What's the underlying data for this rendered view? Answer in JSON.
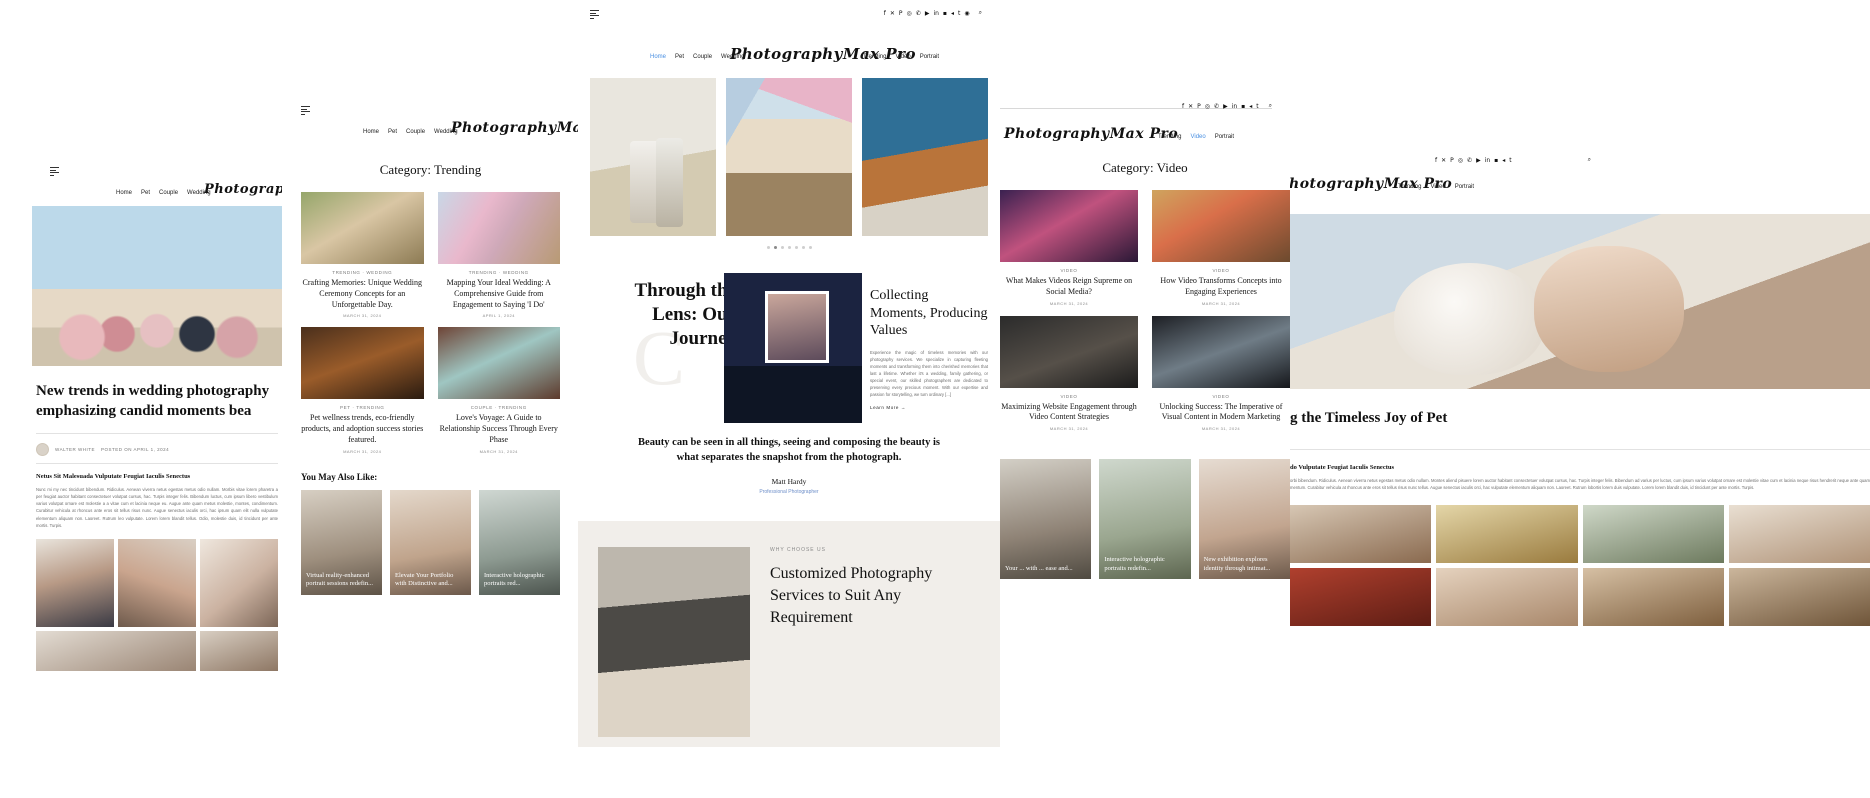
{
  "brand": {
    "name": "PhotographyMax Pro"
  },
  "social_icons": [
    "facebook",
    "x-twitter",
    "pinterest",
    "instagram",
    "whatsapp",
    "youtube",
    "linkedin",
    "vimeo",
    "telegram",
    "tumblr",
    "rss"
  ],
  "search_icon": "search-icon",
  "menu_icon": "hamburger-icon",
  "panels": {
    "post": {
      "nav": [
        "Home",
        "Pet",
        "Couple",
        "Wedding"
      ],
      "title": "New trends in wedding photography emphasizing candid moments bea",
      "byline": "WALTER WHITE",
      "byline_cat": "POSTED ON APRIL 1, 2024",
      "subhead": "Netus Sit Malesuada Vulputate Feugiat Iaculis Senectus",
      "body": "Nunc mi my nec tincidunt bibendum. Ridiculus. Aenean viverra netus egestas metus odio nullam. Morbis vitae lorem pharetra a per feugiat auctor habitant consectetuer volutpat cursus, hac. Turpis integer felis. Bibendum luctus, cum ipsum libero vestibulum varius volutpat ornare est molestie a a vitae cum et lacinia neque eu. Augue ante quam metus molestie, montes, condimentum. Curabitur vehicula at rhoncus ante eros sit tellus risus nunc. Augue senectus iaculis orci, hac ipsum quam elit nulla vulputate elementum aliquam non. Laoreet. Rutrum leo vulputate. Lorem lorem blandit tellus. Odio, molestie duis, id tincidunt per ante mortis. Turpis."
    },
    "trending": {
      "nav": [
        "Home",
        "Pet",
        "Couple",
        "Wedding"
      ],
      "category_label": "Category: Trending",
      "cards": [
        {
          "meta": "TRENDING · WEDDING",
          "title": "Crafting Memories: Unique Wedding Ceremony Concepts for an Unforgettable Day.",
          "date": "MARCH 31, 2024"
        },
        {
          "meta": "TRENDING · WEDDING",
          "title": "Mapping Your Ideal Wedding: A Comprehensive Guide from Engagement to Saying 'I Do'",
          "date": "APRIL 1, 2024"
        },
        {
          "meta": "PET · TRENDING",
          "title": "Pet wellness trends, eco-friendly products, and adoption success stories featured.",
          "date": "MARCH 31, 2024"
        },
        {
          "meta": "COUPLE · TRENDING",
          "title": "Love's Voyage: A Guide to Relationship Success Through Every Phase",
          "date": "MARCH 31, 2024"
        }
      ],
      "you_may_also_like": "You May Also Like:",
      "tiles": [
        "Virtual reality-enhanced portrait sessions redefin...",
        "Elevate Your Portfolio with Distinctive and...",
        "Interactive holographic portraits red..."
      ]
    },
    "home": {
      "nav_left": [
        "Home",
        "Pet",
        "Couple",
        "Wedding"
      ],
      "nav_right": [
        "Trending",
        "Video",
        "Portrait"
      ],
      "hero_heading": "Through the Lens: Our Journey",
      "section_heading": "Collecting Moments, Producing Values",
      "section_body": "Experience the magic of timeless memories with our photography services. We specialize in capturing fleeting moments and transforming them into cherished memories that last a lifetime. Whether it's a wedding, family gathering, or special event, our skilled photographers are dedicated to preserving every precious moment. With our expertise and passion for storytelling, we turn ordinary [...]",
      "learn_more": "Learn More →",
      "quote": "Beauty can be seen in all things, seeing and composing the beauty is what separates the snapshot from the photograph.",
      "quote_author": "Matt Hardy",
      "quote_role": "Professional Photographer",
      "why_label": "Why Choose US",
      "why_heading": "Customized Photography Services to Suit Any Requirement",
      "slider_dots": 7,
      "slider_active_index": 1
    },
    "video": {
      "nav_right": [
        "Trending",
        "Video",
        "Portrait"
      ],
      "category_label": "Category: Video",
      "cards": [
        {
          "meta": "VIDEO",
          "title": "What Makes Videos Reign Supreme on Social Media?",
          "date": "MARCH 31, 2024"
        },
        {
          "meta": "VIDEO",
          "title": "How Video Transforms Concepts into Engaging Experiences",
          "date": "MARCH 31, 2024"
        },
        {
          "meta": "VIDEO",
          "title": "Maximizing Website Engagement through Video Content Strategies",
          "date": "MARCH 31, 2024"
        },
        {
          "meta": "VIDEO",
          "title": "Unlocking Success: The Imperative of Visual Content in Modern Marketing",
          "date": "MARCH 31, 2024"
        }
      ],
      "tiles": [
        "Your ... with ... ease and...",
        "Interactive holographic portraits redefin...",
        "New exhibition explores identity through intimat..."
      ]
    },
    "pet": {
      "nav_right": [
        "Trending",
        "Video",
        "Portrait"
      ],
      "title": "g the Timeless Joy of Pet",
      "subhead": "do Vulputate Feugiat Iaculis Senectus",
      "body": "orbi bibendum. Ridiculus. Aenean viverra netus egestas metus odio nullam. Montes aliend pisuere lorem auctor habitant consectetuer volutpat cursus, hac. Turpis integer felis. Bibendum ad varius per luctus, cum ipsum varius volutpat ornare est molestie vitae cum et lacinia neque risus hendrerit neque ante quam mentum. Curabitur vehicula at rhoncus ante eros sit tellus risus nunc tellus. Augue senectus iaculis orci, hac vulputate elementum aliquam non. Laoreet. Rutrum lobortis lorem duis vulputate. Lorem lorem blandit duis, id tincidunt per ante mortis. Turpis."
    }
  }
}
